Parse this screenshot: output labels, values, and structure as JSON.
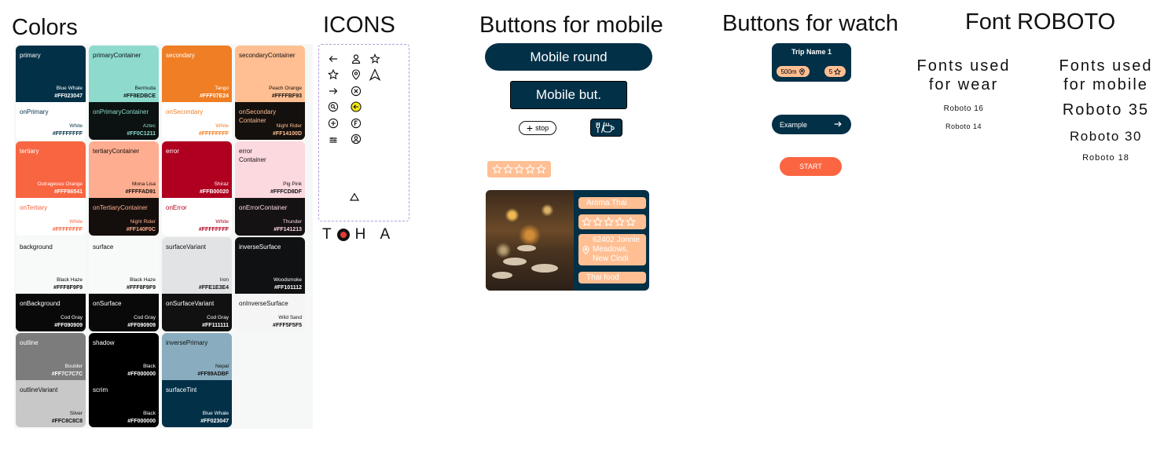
{
  "headings": {
    "colors": "Colors",
    "icons": "ICONS",
    "mobile": "Buttons for mobile",
    "watch": "Buttons for watch",
    "font": "Font ROBOTO"
  },
  "swatches": [
    {
      "label": "primary",
      "name": "Blue Whale",
      "hex": "#FF023047",
      "bg": "#023047",
      "fg": "#ffffff"
    },
    {
      "label": "onPrimary",
      "name": "White",
      "hex": "#FFFFFFFF",
      "bg": "#ffffff",
      "fg": "#023047"
    },
    {
      "label": "primaryContainer",
      "name": "Bermuda",
      "hex": "#FF8EDBCE",
      "bg": "#8edbce",
      "fg": "#0c1211"
    },
    {
      "label": "onPrimaryContainer",
      "name": "Aztec",
      "hex": "#FF0C1211",
      "bg": "#0c1211",
      "fg": "#8edbce"
    },
    {
      "label": "secondary",
      "name": "Tango",
      "hex": "#FFF07E24",
      "bg": "#f07e24",
      "fg": "#ffffff"
    },
    {
      "label": "onSecondary",
      "name": "White",
      "hex": "#FFFFFFFF",
      "bg": "#ffffff",
      "fg": "#f07e24"
    },
    {
      "label": "secondaryContainer",
      "name": "Peach Orange",
      "hex": "#FFFFBF93",
      "bg": "#ffbf93",
      "fg": "#14100d"
    },
    {
      "label": "onSecondary\nContainer",
      "name": "Night Rider",
      "hex": "#FF14100D",
      "bg": "#14100d",
      "fg": "#ffbf93"
    },
    {
      "label": "tertiary",
      "name": "Outrageous Orange",
      "hex": "#FFF86541",
      "bg": "#f86541",
      "fg": "#ffffff"
    },
    {
      "label": "onTertiary",
      "name": "White",
      "hex": "#FFFFFFFF",
      "bg": "#ffffff",
      "fg": "#f86541"
    },
    {
      "label": "tertiaryContainer",
      "name": "Mona Lisa",
      "hex": "#FFFFAD91",
      "bg": "#ffad91",
      "fg": "#140f0c"
    },
    {
      "label": "onTertiaryContainer",
      "name": "Night Rider",
      "hex": "#FF140F0C",
      "bg": "#140f0c",
      "fg": "#ffad91"
    },
    {
      "label": "error",
      "name": "Shiraz",
      "hex": "#FFB00020",
      "bg": "#b00020",
      "fg": "#ffffff"
    },
    {
      "label": "onError",
      "name": "White",
      "hex": "#FFFFFFFF",
      "bg": "#ffffff",
      "fg": "#b00020"
    },
    {
      "label": "error\nContainer",
      "name": "Pig Pink",
      "hex": "#FFFCD8DF",
      "bg": "#fcd8df",
      "fg": "#141213"
    },
    {
      "label": "onErrorContainer",
      "name": "Thunder",
      "hex": "#FF141213",
      "bg": "#141213",
      "fg": "#fcd8df"
    },
    {
      "label": "background",
      "name": "Black Haze",
      "hex": "#FFF8F9F9",
      "bg": "#f8f9f9",
      "fg": "#090909"
    },
    {
      "label": "onBackground",
      "name": "Cod Gray",
      "hex": "#FF090909",
      "bg": "#090909",
      "fg": "#ffffff"
    },
    {
      "label": "surface",
      "name": "Black Haze",
      "hex": "#FFF8F9F9",
      "bg": "#f8f9f9",
      "fg": "#090909"
    },
    {
      "label": "onSurface",
      "name": "Cod Gray",
      "hex": "#FF090909",
      "bg": "#090909",
      "fg": "#ffffff"
    },
    {
      "label": "surfaceVariant",
      "name": "Iron",
      "hex": "#FFE1E3E4",
      "bg": "#e1e3e4",
      "fg": "#111111"
    },
    {
      "label": "onSurfaceVariant",
      "name": "Cod Gray",
      "hex": "#FF111111",
      "bg": "#111111",
      "fg": "#ffffff"
    },
    {
      "label": "inverseSurface",
      "name": "Woodsmoke",
      "hex": "#FF101112",
      "bg": "#101112",
      "fg": "#ffffff"
    },
    {
      "label": "onInverseSurface",
      "name": "Wild Sand",
      "hex": "#FFF5F5F5",
      "bg": "#f5f5f5",
      "fg": "#101112"
    },
    {
      "label": "outline",
      "name": "Boulder",
      "hex": "#FF7C7C7C",
      "bg": "#7c7c7c",
      "fg": "#ffffff"
    },
    {
      "label": "outlineVariant",
      "name": "Silver",
      "hex": "#FFC8C8C8",
      "bg": "#c8c8c8",
      "fg": "#111111"
    },
    {
      "label": "shadow",
      "name": "Black",
      "hex": "#FF000000",
      "bg": "#000000",
      "fg": "#ffffff"
    },
    {
      "label": "scrim",
      "name": "Black",
      "hex": "#FF000000",
      "bg": "#000000",
      "fg": "#ffffff"
    },
    {
      "label": "inversePrimary",
      "name": "Nepal",
      "hex": "#FF89ADBF",
      "bg": "#89adbf",
      "fg": "#111111"
    },
    {
      "label": "surfaceTint",
      "name": "Blue Whale",
      "hex": "#FF023047",
      "bg": "#023047",
      "fg": "#ffffff"
    }
  ],
  "icons": {
    "toha": "T HA"
  },
  "mobile": {
    "round_label": "Mobile round",
    "rect_label": "Mobile but.",
    "stop_label": "stop",
    "rating_stars": 5,
    "restaurant": {
      "name": "Aroma Thai",
      "address": "62402 Jonnie Meadows, New Cindi",
      "cuisine": "Thai food",
      "stars": 5
    }
  },
  "watch": {
    "trip_title": "Trip Name 1",
    "distance": "500m",
    "rating": "5",
    "example_label": "Example",
    "start_label": "START"
  },
  "fonts": {
    "wear_title": "Fonts used\nfor wear",
    "wear_sample_16": "Roboto 16",
    "wear_sample_14": "Roboto 14",
    "mobile_title": "Fonts used\nfor mobile",
    "mobile_sample_35": "Roboto 35",
    "mobile_sample_30": "Roboto 30",
    "mobile_sample_18": "Roboto 18"
  },
  "colors": {
    "brand": "#023047",
    "accent": "#ffbf93",
    "start": "#fb6541",
    "icon_highlight": "#f5e61b"
  }
}
